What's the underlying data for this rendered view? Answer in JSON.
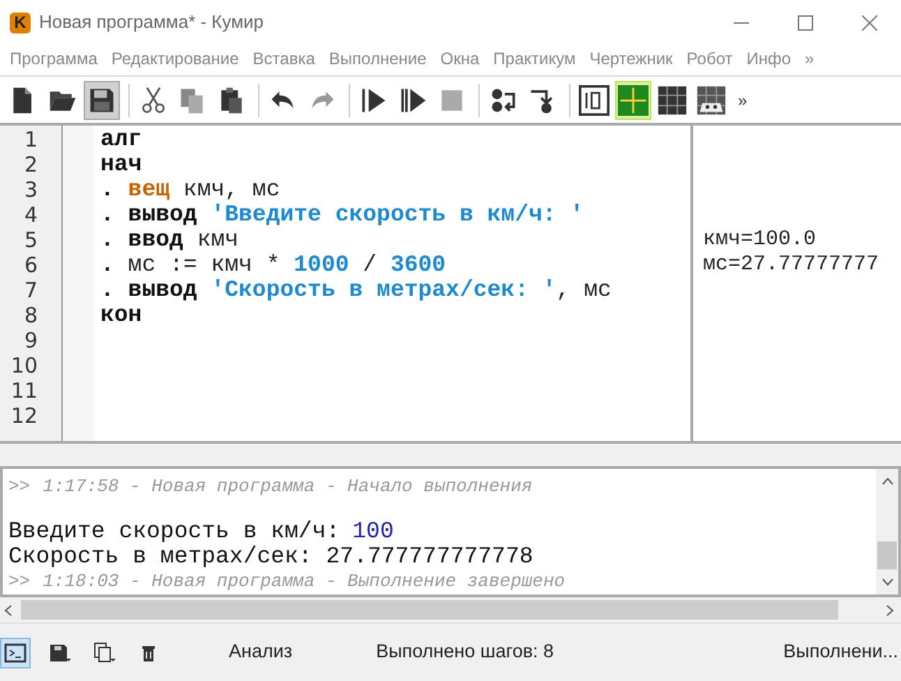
{
  "window": {
    "title": "Новая программа* - Кумир",
    "app_icon": "K"
  },
  "menu": [
    "Программа",
    "Редактирование",
    "Вставка",
    "Выполнение",
    "Окна",
    "Практикум",
    "Чертежник",
    "Робот",
    "Инфо",
    "»"
  ],
  "toolbar": {
    "buttons": [
      {
        "on": false
      },
      {
        "on": false
      },
      {
        "on": true
      },
      {
        "on": false
      },
      {
        "on": false
      },
      {
        "on": false
      },
      {
        "on": false
      },
      {
        "on": false
      },
      {
        "on": false
      },
      {
        "on": false
      },
      {
        "on": false
      },
      {
        "on": false
      },
      {
        "on": false
      },
      {
        "on": false
      },
      {
        "on": true
      },
      {
        "on": false
      },
      {
        "on": false
      }
    ],
    "overflow": "»"
  },
  "editor": {
    "lines": [
      {
        "number": "1",
        "tokens": [
          {
            "kind": "keyword",
            "text": "алг"
          }
        ]
      },
      {
        "number": "2",
        "tokens": [
          {
            "kind": "keyword",
            "text": "нач"
          }
        ]
      },
      {
        "number": "3",
        "tokens": [
          {
            "kind": "dot",
            "text": "."
          },
          {
            "kind": "type",
            "text": " вещ"
          },
          {
            "kind": "plain",
            "text": " кмч, мс"
          }
        ]
      },
      {
        "number": "4",
        "tokens": [
          {
            "kind": "dot",
            "text": "."
          },
          {
            "kind": "keyword",
            "text": " вывод"
          },
          {
            "kind": "string",
            "text": " 'Введите скорость в км/ч: '"
          }
        ]
      },
      {
        "number": "5",
        "tokens": [
          {
            "kind": "dot",
            "text": "."
          },
          {
            "kind": "keyword",
            "text": " ввод"
          },
          {
            "kind": "plain",
            "text": " кмч"
          }
        ],
        "value": "кмч=100.0"
      },
      {
        "number": "6",
        "tokens": [
          {
            "kind": "dot",
            "text": "."
          },
          {
            "kind": "plain",
            "text": " мс :="
          },
          {
            "kind": "plain",
            "text": " кмч *"
          },
          {
            "kind": "number",
            "text": " 1000"
          },
          {
            "kind": "plain",
            "text": " /"
          },
          {
            "kind": "number",
            "text": " 3600"
          }
        ],
        "value": "мс=27.77777777"
      },
      {
        "number": "7",
        "tokens": [
          {
            "kind": "dot",
            "text": "."
          },
          {
            "kind": "keyword",
            "text": " вывод"
          },
          {
            "kind": "string",
            "text": " 'Скорость в метрах/сек: '"
          },
          {
            "kind": "plain",
            "text": ", мс"
          }
        ]
      },
      {
        "number": "8",
        "tokens": [
          {
            "kind": "keyword",
            "text": "кон"
          }
        ]
      },
      {
        "number": "9"
      },
      {
        "number": "10"
      },
      {
        "number": "11"
      },
      {
        "number": "12"
      }
    ]
  },
  "console": {
    "lines": [
      {
        "kind": "log",
        "prompt": ">>",
        "text": "1:17:58 - Новая программа - Начало выполнения"
      },
      {
        "kind": "blank"
      },
      {
        "kind": "output",
        "parts": [
          {
            "kind": "output",
            "text": "Введите скорость в км/ч:"
          },
          {
            "kind": "input",
            "text": "100"
          }
        ]
      },
      {
        "kind": "output",
        "parts": [
          {
            "kind": "output",
            "text": "Скорость в метрах/сек: 27.777777777778"
          }
        ]
      },
      {
        "kind": "log",
        "prompt": ">>",
        "text": "1:18:03 - Новая программа - Выполнение завершено"
      }
    ]
  },
  "status_bar": {
    "buttons": [
      {
        "selected": true
      },
      {
        "selected": false
      },
      {
        "selected": false
      },
      {
        "selected": false
      }
    ],
    "mode": "Анализ",
    "steps": "Выполнено шагов: 8",
    "state": "Выполнени..."
  }
}
